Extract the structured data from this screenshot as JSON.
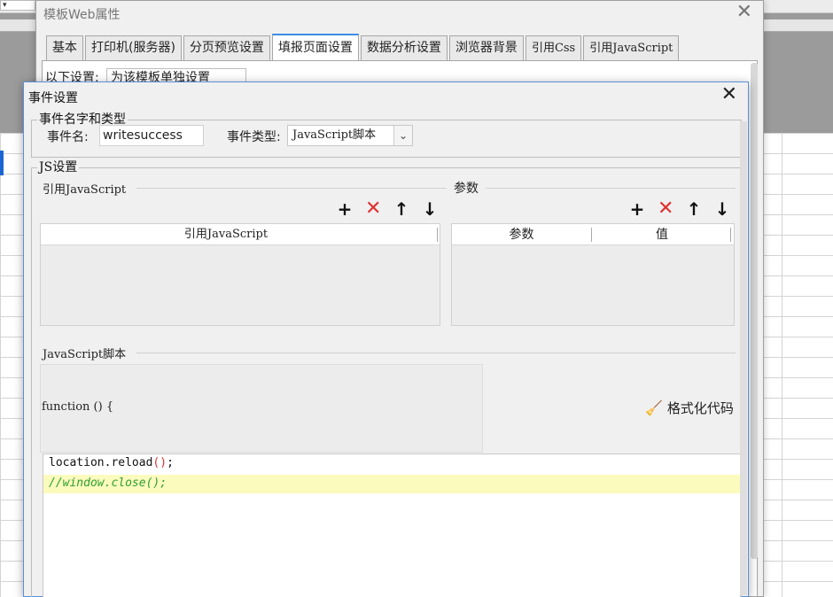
{
  "background": {
    "mini_field": "▾"
  },
  "outer_dialog": {
    "title": "模板Web属性",
    "close": "✕",
    "tabs": [
      {
        "label": "基本"
      },
      {
        "label": "打印机(服务器)"
      },
      {
        "label": "分页预览设置"
      },
      {
        "label": "填报页面设置",
        "active": true
      },
      {
        "label": "数据分析设置"
      },
      {
        "label": "浏览器背景"
      },
      {
        "label": "引用Css"
      },
      {
        "label": "引用JavaScript"
      }
    ],
    "settings_label": "以下设置:",
    "settings_value": "为该模板单独设置"
  },
  "inner_dialog": {
    "title": "事件设置",
    "close": "✕",
    "name_section": {
      "legend": "事件名字和类型",
      "name_label": "事件名:",
      "name_value": "writesuccess",
      "type_label": "事件类型:",
      "type_value": "JavaScript脚本",
      "dropdown_icon": "⌄"
    },
    "js_section": {
      "legend": "JS设置",
      "ref_title": "引用JavaScript",
      "param_title": "参数",
      "toolbar": {
        "add": "+",
        "delete": "✕",
        "up": "↑",
        "down": "↓"
      },
      "ref_table_header": "引用JavaScript",
      "param_table_headers": [
        "参数",
        "值"
      ],
      "script_title": "JavaScript脚本",
      "function_signature": "function () {",
      "format_button": "格式化代码",
      "code_lines": [
        {
          "text": "location.reload",
          "paren": "()",
          "end": ";"
        },
        {
          "text": "//window.close();"
        }
      ]
    }
  },
  "colors": {
    "accent": "#3a8ee6",
    "delete": "#e03030",
    "comment": "#2ea02e",
    "highlight": "#fbfbbd"
  }
}
